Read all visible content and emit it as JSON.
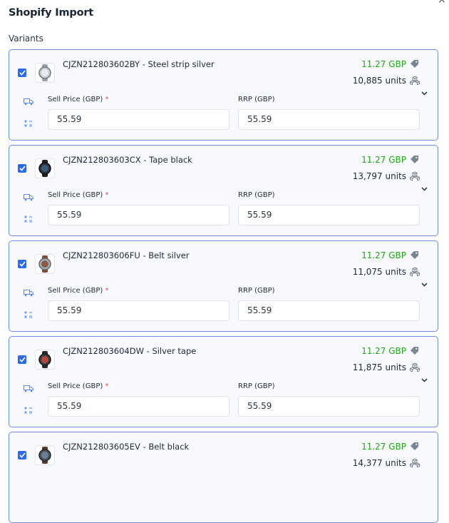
{
  "header": {
    "title": "Shopify Import",
    "close": "×"
  },
  "section_label": "Variants",
  "fields": {
    "sell_label": "Sell Price (GBP)",
    "required_mark": "*",
    "rrp_label": "RRP (GBP)"
  },
  "colors": {
    "accent": "#2f6ae6",
    "price": "#26a51c",
    "card_border": "#6f8fe0",
    "required": "#e5484d"
  },
  "variants": [
    {
      "name": "CJZN212803602BY - Steel strip silver",
      "price": "11.27 GBP",
      "units": "10,885 units",
      "sell_price": "55.59",
      "rrp": "55.59",
      "checked": true,
      "thumb_icon": "watch-silver-icon"
    },
    {
      "name": "CJZN212803603CX - Tape black",
      "price": "11.27 GBP",
      "units": "13,797 units",
      "sell_price": "55.59",
      "rrp": "55.59",
      "checked": true,
      "thumb_icon": "watch-black-icon"
    },
    {
      "name": "CJZN212803606FU - Belt silver",
      "price": "11.27 GBP",
      "units": "11,075 units",
      "sell_price": "55.59",
      "rrp": "55.59",
      "checked": true,
      "thumb_icon": "watch-brown-icon"
    },
    {
      "name": "CJZN212803604DW - Silver tape",
      "price": "11.27 GBP",
      "units": "11,875 units",
      "sell_price": "55.59",
      "rrp": "55.59",
      "checked": true,
      "thumb_icon": "watch-red-icon"
    },
    {
      "name": "CJZN212803605EV - Belt black",
      "price": "11.27 GBP",
      "units": "14,377 units",
      "checked": true,
      "thumb_icon": "watch-dark-icon"
    }
  ]
}
